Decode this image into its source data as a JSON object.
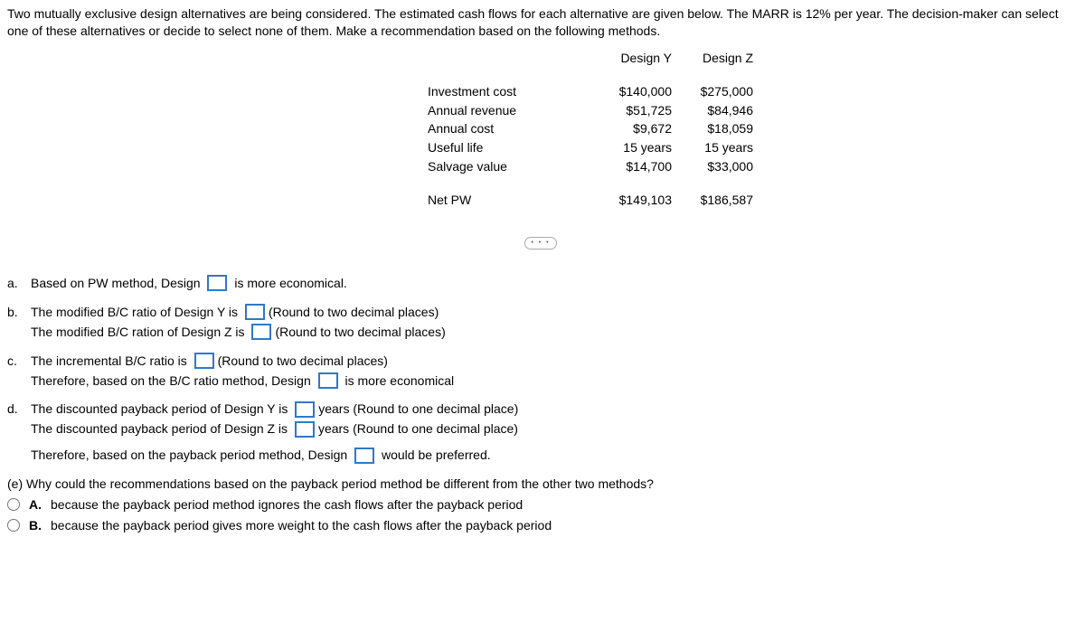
{
  "intro": "Two mutually exclusive design alternatives are being considered. The estimated cash flows for each alternative are given below. The MARR is 12% per year. The decision-maker can select one of these alternatives or decide to select none of them. Make a recommendation based on the following methods.",
  "table": {
    "col_y": "Design Y",
    "col_z": "Design Z",
    "rows": [
      {
        "label": "Investment cost",
        "y": "$140,000",
        "z": "$275,000"
      },
      {
        "label": "Annual revenue",
        "y": "$51,725",
        "z": "$84,946"
      },
      {
        "label": "Annual cost",
        "y": "$9,672",
        "z": "$18,059"
      },
      {
        "label": "Useful life",
        "y": "15 years",
        "z": "15 years"
      },
      {
        "label": "Salvage value",
        "y": "$14,700",
        "z": "$33,000"
      }
    ],
    "netpw": {
      "label": "Net PW",
      "y": "$149,103",
      "z": "$186,587"
    }
  },
  "more": "• • •",
  "q": {
    "a": {
      "marker": "a.",
      "t1": "Based on PW method, Design ",
      "t2": " is more economical."
    },
    "b": {
      "marker": "b.",
      "l1a": "The modified B/C ratio of Design Y is ",
      "l1b": "(Round to two decimal places)",
      "l2a": "The modified B/C ration of Design Z is ",
      "l2b": "(Round to two decimal places)"
    },
    "c": {
      "marker": "c.",
      "l1a": "The incremental B/C ratio is ",
      "l1b": "(Round to two decimal places)",
      "l2a": "Therefore, based on the B/C ratio method, Design ",
      "l2b": " is more economical"
    },
    "d": {
      "marker": "d.",
      "l1a": "The discounted payback period of Design Y is ",
      "l1b": "years ",
      "l1c": "(Round to one decimal place)",
      "l2a": "The discounted payback period of Design Z is ",
      "l2b": "years ",
      "l2c": "(Round to one decimal place)",
      "l3a": "Therefore, based on the payback period method, Design ",
      "l3b": " would be preferred."
    },
    "e": {
      "prompt": "(e) Why could the recommendations based on the payback period method be different from the other two methods?",
      "optA_letter": "A.",
      "optA": "because the payback period method ignores the cash flows after the payback period",
      "optB_letter": "B.",
      "optB": "because the payback period gives more weight to the cash flows after the payback period"
    }
  }
}
